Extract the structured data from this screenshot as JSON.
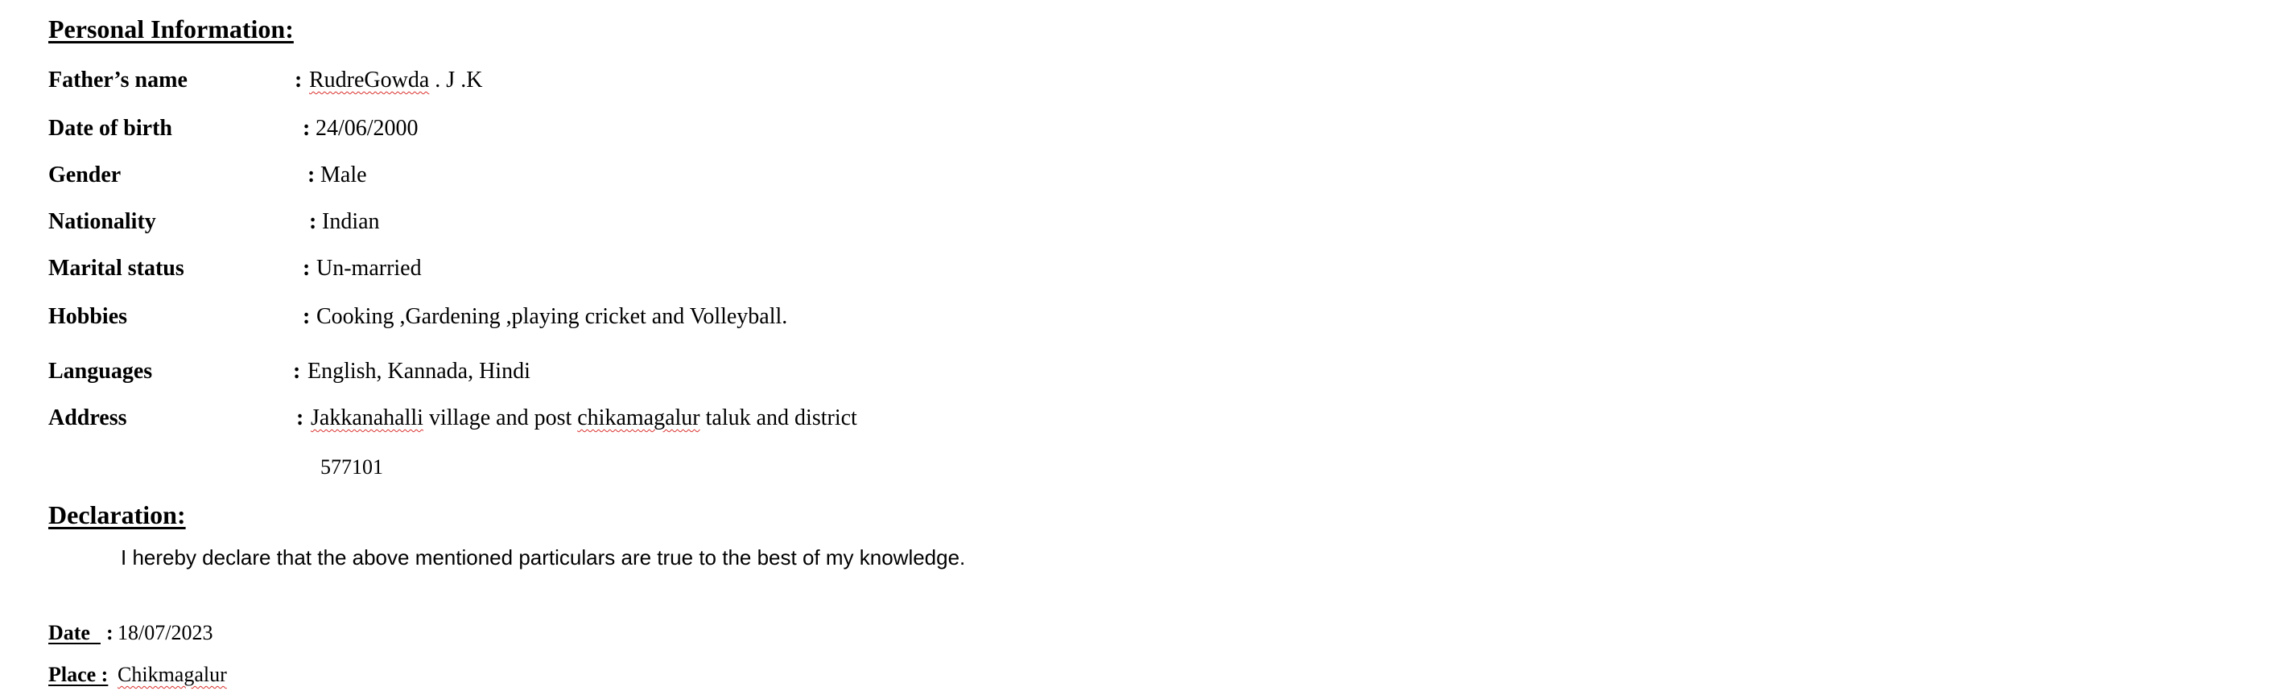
{
  "personal_info": {
    "heading": "Personal Information:",
    "fields": [
      {
        "label": "Father’s name",
        "value_parts": [
          "RudreGowda",
          " . J .K"
        ]
      },
      {
        "label": "Date of birth",
        "value": "24/06/2000"
      },
      {
        "label": "Gender",
        "value": "Male"
      },
      {
        "label": "Nationality",
        "value": "Indian"
      },
      {
        "label": "Marital status",
        "value": "Un-married"
      },
      {
        "label": "Hobbies",
        "value": "Cooking ,Gardening ,playing cricket and Volleyball."
      },
      {
        "label": "Languages",
        "value": "English, Kannada, Hindi"
      },
      {
        "label": "Address",
        "value_parts": [
          "Jakkanahalli",
          " village and post ",
          "chikamagalur",
          " taluk and district"
        ],
        "value_line2": "577101"
      }
    ],
    "separator": ":"
  },
  "declaration": {
    "heading": "Declaration:",
    "text": "I hereby declare that the above mentioned particulars are true to the best of my knowledge."
  },
  "footer": {
    "date_label": "Date",
    "date_value": "18/07/2023",
    "place_label": "Place :",
    "place_value": "Chikmagalur",
    "separator": ":"
  }
}
